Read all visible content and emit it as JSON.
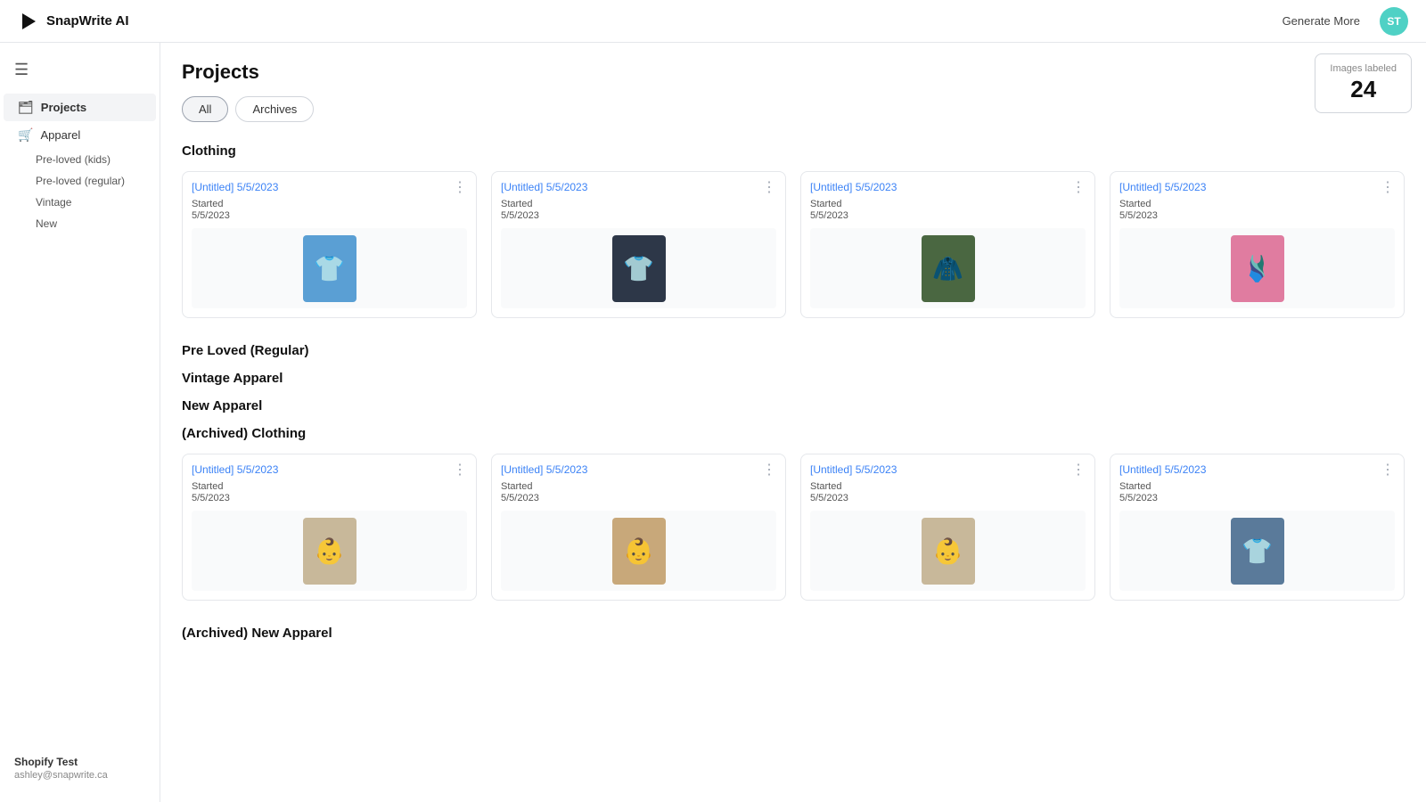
{
  "app": {
    "name": "SnapWrite AI",
    "logo_unicode": "▶"
  },
  "navbar": {
    "generate_more_label": "Generate More",
    "avatar_initials": "ST"
  },
  "sidebar": {
    "menu_icon": "☰",
    "items": [
      {
        "id": "projects",
        "label": "Projects",
        "icon": "🗂",
        "active": true
      },
      {
        "id": "apparel",
        "label": "Apparel",
        "icon": "🛒"
      }
    ],
    "sub_items": [
      {
        "id": "pre-loved-kids",
        "label": "Pre-loved (kids)"
      },
      {
        "id": "pre-loved-regular",
        "label": "Pre-loved (regular)"
      },
      {
        "id": "vintage",
        "label": "Vintage"
      },
      {
        "id": "new",
        "label": "New"
      }
    ],
    "footer": {
      "store": "Shopify Test",
      "email": "ashley@snapwrite.ca"
    }
  },
  "main": {
    "page_title": "Projects",
    "filter_tabs": [
      {
        "id": "all",
        "label": "All",
        "active": true
      },
      {
        "id": "archives",
        "label": "Archives",
        "active": false
      }
    ],
    "images_labeled": {
      "label": "Images labeled",
      "count": "24"
    },
    "sections": [
      {
        "id": "clothing",
        "title": "Clothing",
        "projects": [
          {
            "title": "[Untitled] 5/5/2023",
            "status": "Started",
            "date": "5/5/2023",
            "color": "#5a9fd4"
          },
          {
            "title": "[Untitled] 5/5/2023",
            "status": "Started",
            "date": "5/5/2023",
            "color": "#2d3748"
          },
          {
            "title": "[Untitled] 5/5/2023",
            "status": "Started",
            "date": "5/5/2023",
            "color": "#4a6741"
          },
          {
            "title": "[Untitled] 5/5/2023",
            "status": "Started",
            "date": "5/5/2023",
            "color": "#e07ca0"
          }
        ]
      },
      {
        "id": "pre-loved-regular",
        "title": "Pre Loved (Regular)",
        "projects": []
      },
      {
        "id": "vintage-apparel",
        "title": "Vintage Apparel",
        "projects": []
      },
      {
        "id": "new-apparel",
        "title": "New Apparel",
        "projects": []
      },
      {
        "id": "archived-clothing",
        "title": "(Archived) Clothing",
        "projects": [
          {
            "title": "[Untitled] 5/5/2023",
            "status": "Started",
            "date": "5/5/2023",
            "color": "#c8b89a"
          },
          {
            "title": "[Untitled] 5/5/2023",
            "status": "Started",
            "date": "5/5/2023",
            "color": "#c8a87a"
          },
          {
            "title": "[Untitled] 5/5/2023",
            "status": "Started",
            "date": "5/5/2023",
            "color": "#c8b89a"
          },
          {
            "title": "[Untitled] 5/5/2023",
            "status": "Started",
            "date": "5/5/2023",
            "color": "#5a7a9a"
          }
        ]
      },
      {
        "id": "archived-new-apparel",
        "title": "(Archived) New Apparel",
        "projects": []
      }
    ]
  }
}
